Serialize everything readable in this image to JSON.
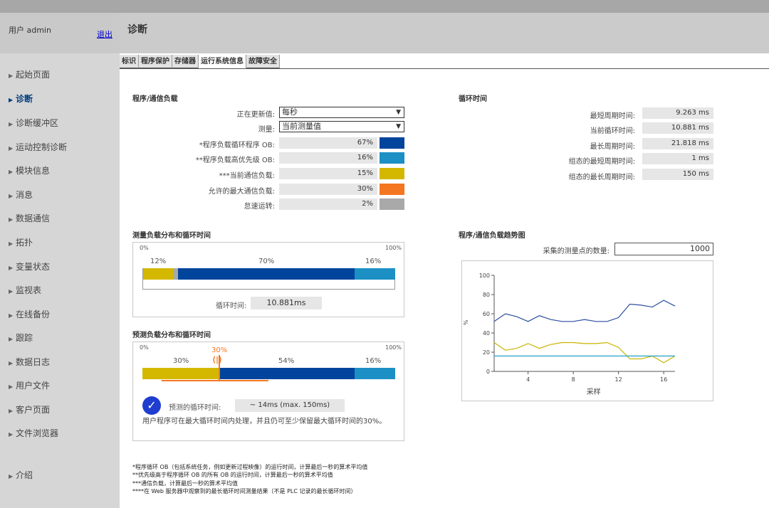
{
  "user": {
    "label": "用户 admin",
    "logout": "退出"
  },
  "header": {
    "title": "诊断"
  },
  "nav": [
    {
      "label": "起始页面"
    },
    {
      "label": "诊断"
    },
    {
      "label": "诊断缓冲区"
    },
    {
      "label": "运动控制诊断"
    },
    {
      "label": "模块信息"
    },
    {
      "label": "消息"
    },
    {
      "label": "数据通信"
    },
    {
      "label": "拓扑"
    },
    {
      "label": "变量状态"
    },
    {
      "label": "监视表"
    },
    {
      "label": "在线备份"
    },
    {
      "label": "跟踪"
    },
    {
      "label": "数据日志"
    },
    {
      "label": "用户文件"
    },
    {
      "label": "客户页面"
    },
    {
      "label": "文件浏览器"
    },
    {
      "label": "介绍"
    }
  ],
  "tabs": [
    "标识",
    "程序保护",
    "存储器",
    "运行系统信息",
    "故障安全"
  ],
  "load": {
    "title": "程序/通信负载",
    "refresh_label": "正在更新值:",
    "refresh_value": "每秒",
    "measure_label": "测量:",
    "measure_value": "当前测量值",
    "rows": [
      {
        "label": "*程序负载循环程序 OB:",
        "value": "67%",
        "color": "#00449c"
      },
      {
        "label": "**程序负载高优先级 OB:",
        "value": "16%",
        "color": "#1c8fc4"
      },
      {
        "label": "***当前通信负载:",
        "value": "15%",
        "color": "#d4b800"
      },
      {
        "label": "允许的最大通信负载:",
        "value": "30%",
        "color": "#f47621"
      },
      {
        "label": "怠速运转:",
        "value": "2%",
        "color": "#a9a9a9"
      }
    ]
  },
  "cycle": {
    "title": "循环时间",
    "rows": [
      {
        "label": "最短周期时间:",
        "value": "9.263 ms"
      },
      {
        "label": "当前循环时间:",
        "value": "10.881 ms"
      },
      {
        "label": "最长周期时间:",
        "value": "21.818 ms"
      },
      {
        "label": "组态的最短周期时间:",
        "value": "1 ms"
      },
      {
        "label": "组态的最长周期时间:",
        "value": "150 ms"
      }
    ]
  },
  "measured": {
    "title": "测量负载分布和循环时间",
    "left": "0%",
    "right": "100%",
    "p1": "12%",
    "p2": "70%",
    "p3": "16%",
    "segments": [
      12,
      1,
      70,
      16
    ],
    "cycle_label": "循环时间:",
    "cycle_value": "10.881ms"
  },
  "predicted": {
    "title": "预测负载分布和循环时间",
    "left": "0%",
    "right": "100%",
    "marker": "30%",
    "p1": "30%",
    "p2": "54%",
    "p3": "16%",
    "segments": [
      30,
      54,
      16
    ],
    "cycle_label": "预测的循环时间:",
    "cycle_value": "~ 14ms  (max. 150ms)",
    "message": "用户程序可在最大循环时间内处理，并且仍可至少保留最大循环时间的30%。",
    "check_icon": "check-circle-icon"
  },
  "trend": {
    "title": "程序/通信负载趋势图",
    "points_label": "采集的测量点的数量:",
    "points_value": "1000"
  },
  "chart_data": {
    "type": "line",
    "ylabel": "%",
    "xlabel": "采样",
    "ylim": [
      0,
      100
    ],
    "y_ticks": [
      "0",
      "20",
      "40",
      "60",
      "80",
      "100"
    ],
    "x_ticks": [
      "4",
      "8",
      "12",
      "16"
    ],
    "x": [
      1,
      2,
      3,
      4,
      5,
      6,
      7,
      8,
      9,
      10,
      11,
      12,
      13,
      14,
      15,
      16,
      17
    ],
    "series": [
      {
        "color": "#2b4fa0",
        "values": [
          52,
          60,
          57,
          52,
          58,
          54,
          52,
          52,
          54,
          52,
          52,
          56,
          70,
          69,
          67,
          74,
          68
        ]
      },
      {
        "color": "#c9b300",
        "values": [
          30,
          22,
          24,
          29,
          24,
          28,
          30,
          30,
          29,
          29,
          30,
          25,
          13,
          13,
          16,
          9,
          16
        ]
      },
      {
        "color": "#26a3c8",
        "values": [
          16,
          16,
          16,
          16,
          16,
          16,
          16,
          16,
          16,
          16,
          16,
          16,
          16,
          16,
          16,
          16,
          16
        ]
      }
    ]
  },
  "footnotes": [
    "*程序循环 OB（包括系统任务，例如更新过程映像）的运行时间，计算最后一秒的算术平均值",
    "**优先级高于程序循环 OB 的所有 OB 的运行时间，计算最后一秒的算术平均值",
    "***通信负载，计算最后一秒的算术平均值",
    "****在 Web 服务器中观察到的最长循环时间测量结果（不是 PLC 记录的最长循环时间）"
  ]
}
